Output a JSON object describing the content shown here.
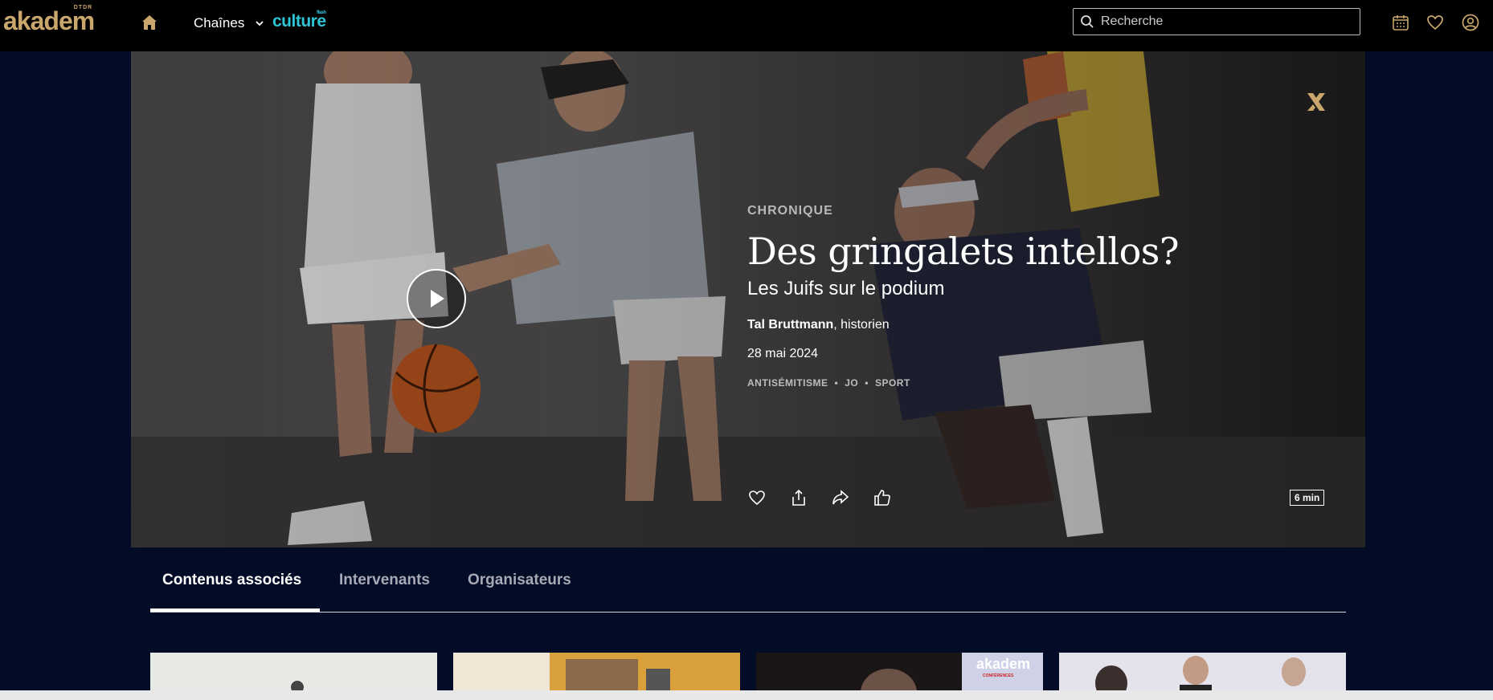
{
  "header": {
    "logo_text": "akadem",
    "logo_sup": "DTDR",
    "nav_chaines": "Chaînes",
    "culture_text": "culture",
    "culture_sup": "flash",
    "search_placeholder": "Recherche"
  },
  "hero": {
    "category": "CHRONIQUE",
    "title": "Des gringalets intellos?",
    "subtitle": "Les Juifs sur le podium",
    "speaker_name": "Tal Bruttmann",
    "speaker_role": ", historien",
    "date": "28 mai 2024",
    "tags": [
      "ANTISÉMITISME",
      "JO",
      "SPORT"
    ],
    "tag_separator": "•",
    "duration": "6 min"
  },
  "tabs": [
    {
      "label": "Contenus associés",
      "active": true
    },
    {
      "label": "Intervenants",
      "active": false
    },
    {
      "label": "Organisateurs",
      "active": false
    }
  ],
  "cards": [
    {
      "image": "related-card-image"
    },
    {
      "image": "related-card-image"
    },
    {
      "image": "related-card-image",
      "overlay_text": "akadem",
      "overlay_sub": "CONFÉRENCES"
    },
    {
      "image": "related-card-image"
    }
  ],
  "colors": {
    "page_bg": "#030c26",
    "topbar_bg": "#000000",
    "gold": "#c9a66b",
    "culture_cyan": "#2ec4d6"
  }
}
